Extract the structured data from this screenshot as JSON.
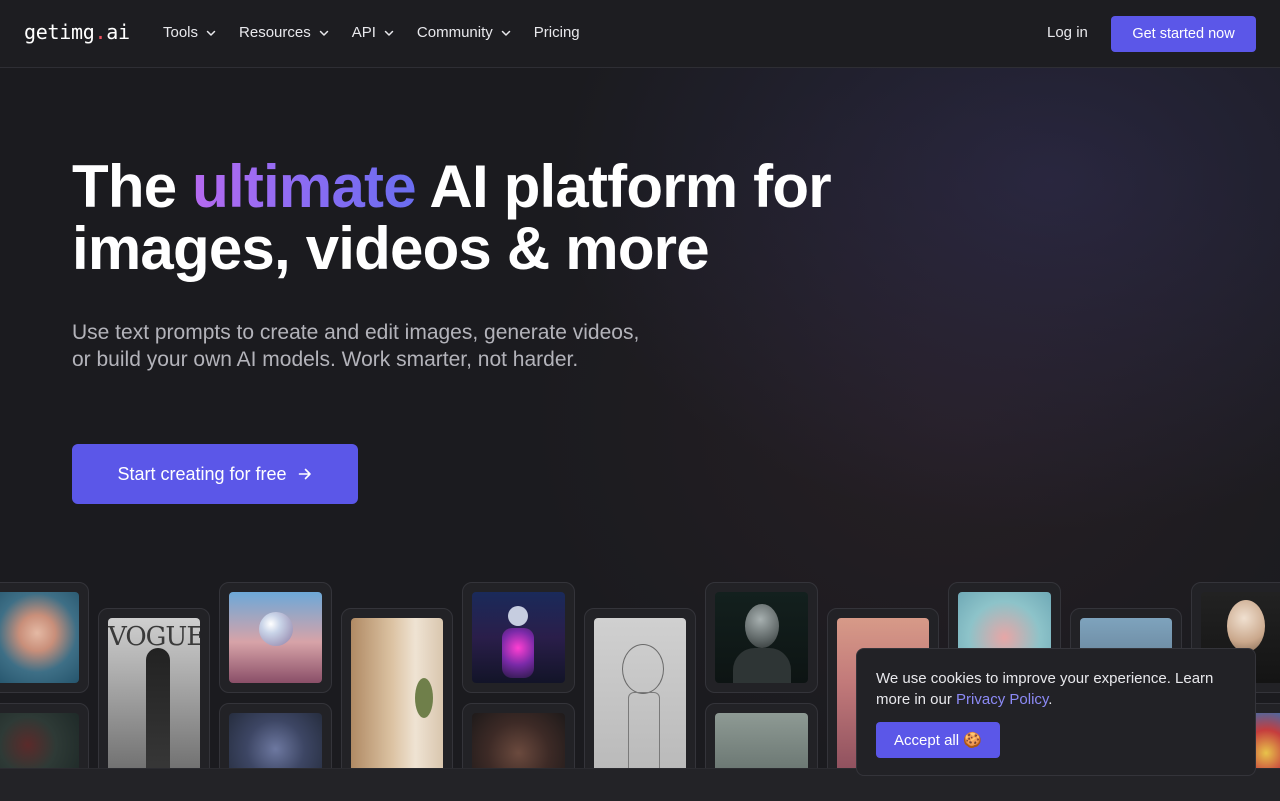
{
  "brand": {
    "name_main": "getimg",
    "name_dot": ".",
    "name_tld": "ai",
    "dot_color": "#ef4f5d"
  },
  "nav": {
    "items": [
      {
        "label": "Tools",
        "has_dropdown": true
      },
      {
        "label": "Resources",
        "has_dropdown": true
      },
      {
        "label": "API",
        "has_dropdown": true
      },
      {
        "label": "Community",
        "has_dropdown": true
      },
      {
        "label": "Pricing",
        "has_dropdown": false
      }
    ],
    "login_label": "Log in",
    "cta_label": "Get started now"
  },
  "hero": {
    "headline_prefix": "The ",
    "headline_highlight": "ultimate",
    "headline_suffix": " AI platform for",
    "headline_line2": "images, videos & more",
    "subtitle": "Use text prompts to create and edit images, generate videos, or build your own AI models. Work smarter, not harder.",
    "cta_label": "Start creating for free",
    "cta_icon": "arrow-right-icon"
  },
  "gallery": {
    "images": [
      "woman-face-portrait",
      "dark-red-portrait",
      "vogue-cover-statue",
      "glass-sphere-landscape",
      "cyborg-portrait",
      "minimal-interior-room",
      "neon-robot-city",
      "woman-eyes-closeup",
      "pencil-sketch-figure",
      "alien-bust-dark",
      "misty-figure",
      "pink-room-lights",
      "pink-smoke-figure",
      "window-sky-view",
      "porcelain-woman-bust",
      "colorful-balloons"
    ]
  },
  "cookie": {
    "text_before": "We use cookies to improve your experience. Learn more in our ",
    "link_label": "Privacy Policy",
    "text_after": ".",
    "accept_label": "Accept all",
    "accept_emoji": "🍪"
  },
  "colors": {
    "accent": "#5b57e8",
    "background": "#1b1b1f",
    "highlight_start": "#b66af0",
    "highlight_end": "#6a6df0"
  }
}
